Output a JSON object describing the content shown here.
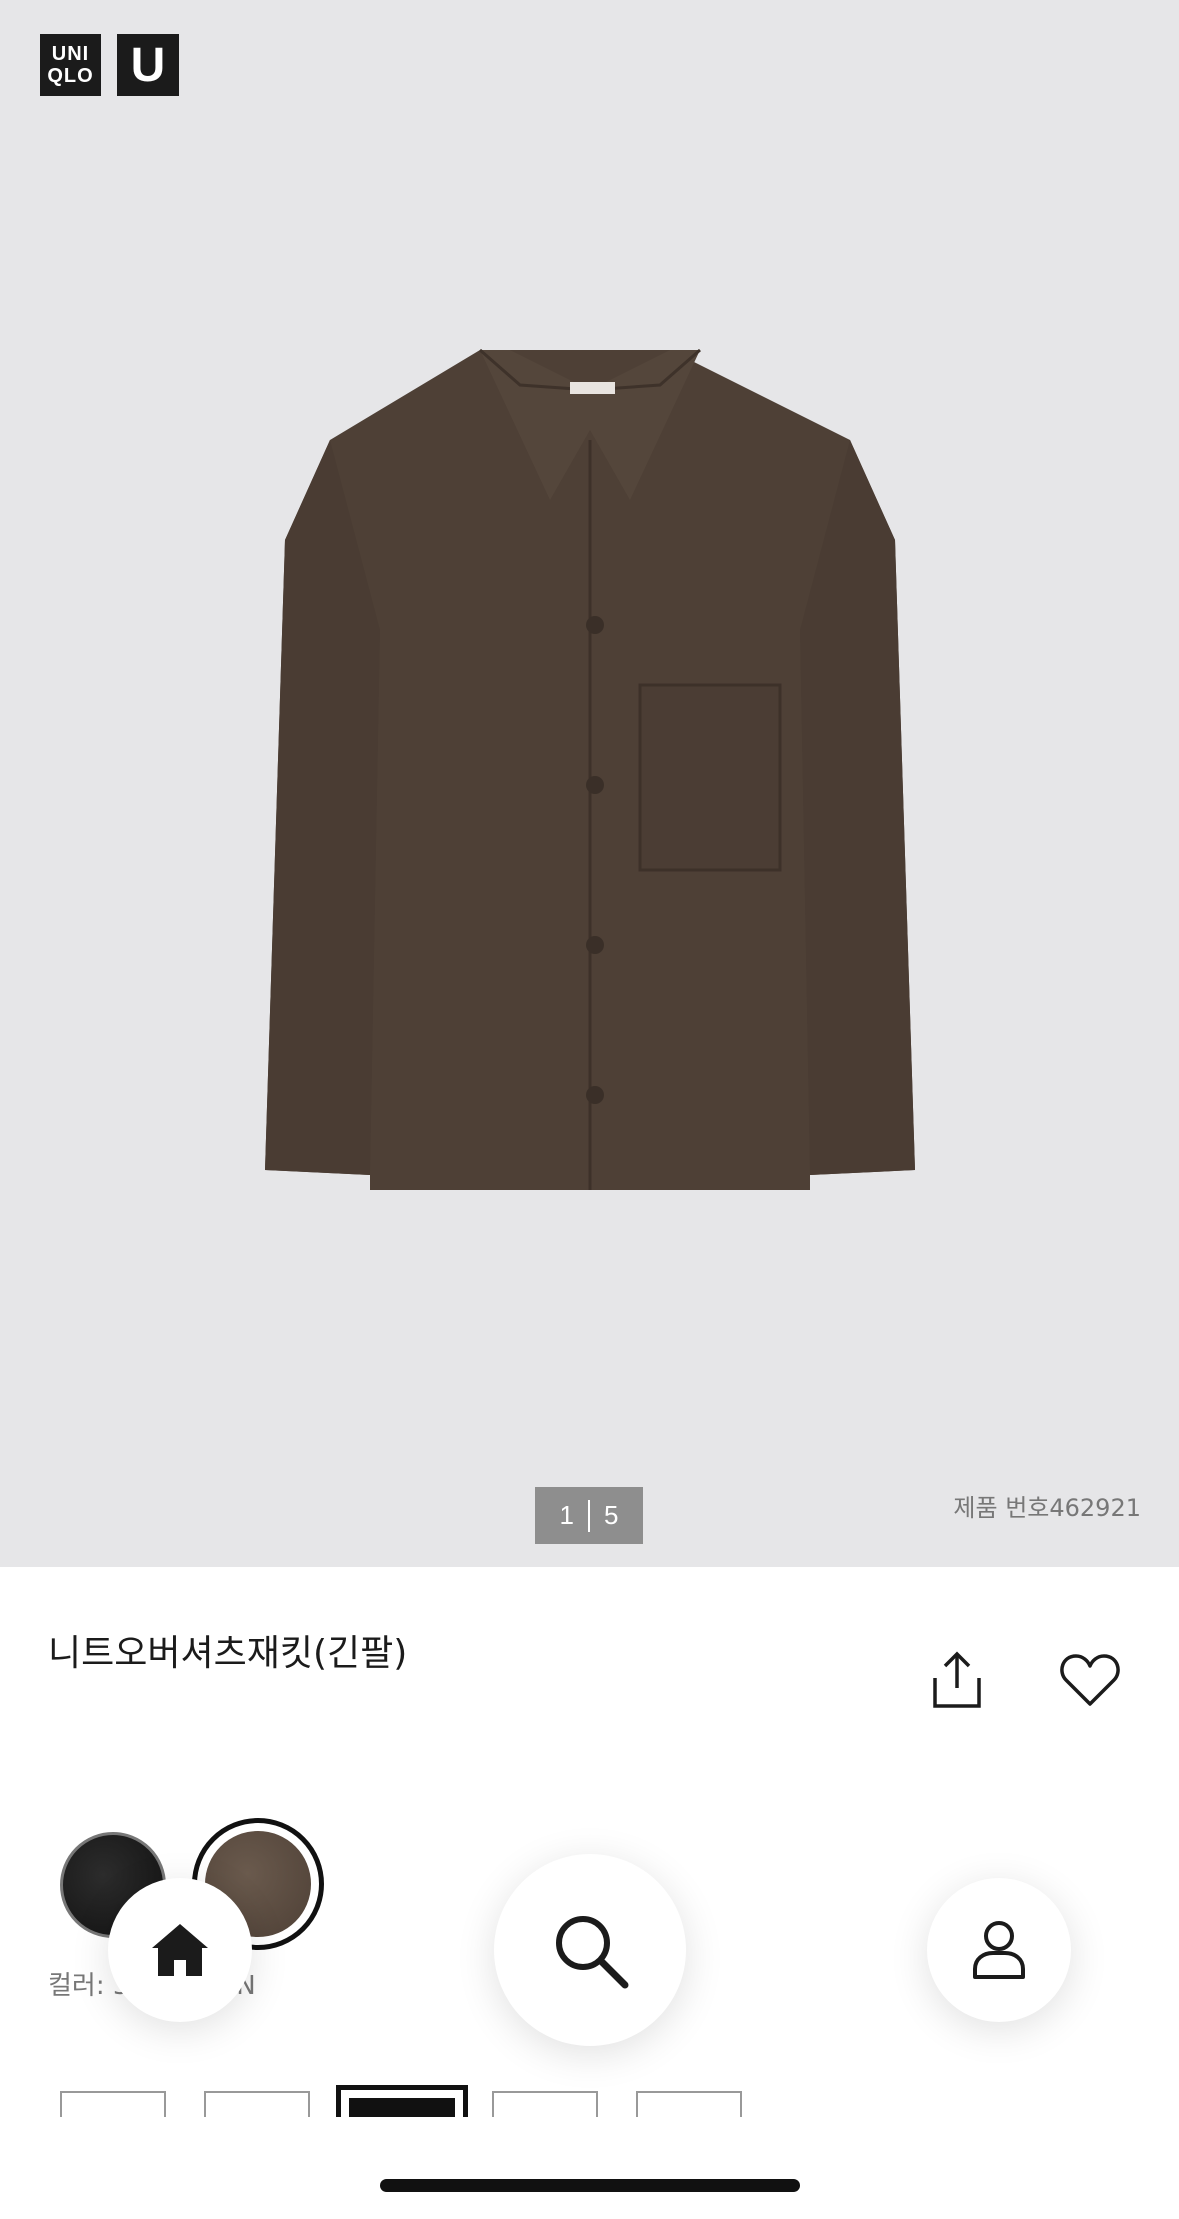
{
  "brand": {
    "logo_line1": "UNI",
    "logo_line2": "QLO",
    "logo_u": "U"
  },
  "gallery": {
    "current": "1",
    "total": "5"
  },
  "product": {
    "number_label": "제품 번호462921",
    "title": "니트오버셔츠재킷(긴팔)",
    "color_label": "컬러: 38 BROWN"
  },
  "icons": {
    "share": "share-icon",
    "favorite": "heart-icon",
    "home": "home-icon",
    "search": "search-icon",
    "account": "person-icon"
  },
  "colors": {
    "hero_background": "#e6e6e8",
    "swatch_black": "#1f1f1f",
    "swatch_brown": "#5b4c40",
    "pager_background": "#8e8e8e"
  }
}
